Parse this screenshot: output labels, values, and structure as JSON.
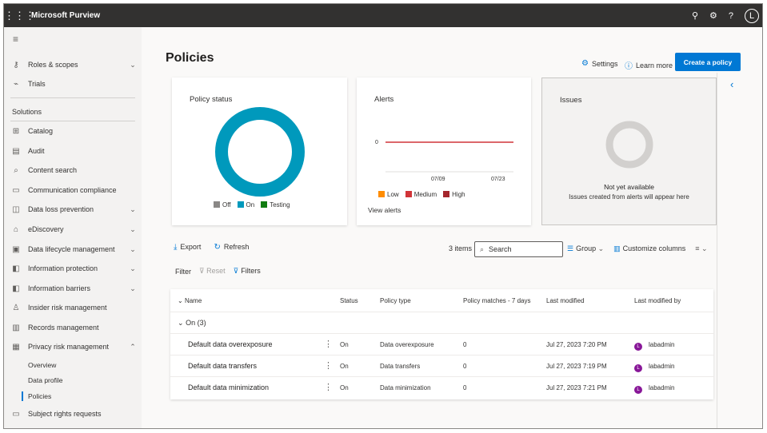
{
  "app": {
    "title": "Microsoft Purview",
    "avatar_initial": "L"
  },
  "topbar_icons": [
    "share-icon",
    "gear-icon",
    "help-icon"
  ],
  "sidebar": {
    "items_top": [
      {
        "label": "Roles & scopes",
        "icon": "key-icon",
        "chevron": true
      },
      {
        "label": "Trials",
        "icon": "trial-icon",
        "chevron": false
      }
    ],
    "solutions_heading": "Solutions",
    "items": [
      {
        "label": "Catalog",
        "icon": "catalog-icon",
        "chevron": false
      },
      {
        "label": "Audit",
        "icon": "audit-icon",
        "chevron": false
      },
      {
        "label": "Content search",
        "icon": "search-icon",
        "chevron": false
      },
      {
        "label": "Communication compliance",
        "icon": "chat-icon",
        "chevron": false
      },
      {
        "label": "Data loss prevention",
        "icon": "dlp-icon",
        "chevron": true
      },
      {
        "label": "eDiscovery",
        "icon": "ediscovery-icon",
        "chevron": true
      },
      {
        "label": "Data lifecycle management",
        "icon": "lifecycle-icon",
        "chevron": true
      },
      {
        "label": "Information protection",
        "icon": "protection-icon",
        "chevron": true
      },
      {
        "label": "Information barriers",
        "icon": "barrier-icon",
        "chevron": true
      },
      {
        "label": "Insider risk management",
        "icon": "insider-icon",
        "chevron": false
      },
      {
        "label": "Records management",
        "icon": "records-icon",
        "chevron": false
      },
      {
        "label": "Privacy risk management",
        "icon": "privacy-icon",
        "chevron": true
      }
    ],
    "subitems": [
      "Overview",
      "Data profile",
      "Policies"
    ],
    "bottom_item": {
      "label": "Subject rights requests",
      "icon": "subject-icon"
    }
  },
  "main": {
    "title": "Policies",
    "settings_label": "Settings",
    "learn_more_label": "Learn more",
    "create_label": "Create a policy"
  },
  "cards": {
    "policy_status": {
      "title": "Policy status",
      "legend": [
        {
          "label": "Off",
          "color": "#8a8886"
        },
        {
          "label": "On",
          "color": "#0099bc"
        },
        {
          "label": "Testing",
          "color": "#107c10"
        }
      ]
    },
    "alerts": {
      "title": "Alerts",
      "y_label": "0",
      "x_labels": [
        "07/09",
        "07/23"
      ],
      "legend": [
        {
          "label": "Low",
          "color": "#ff8c00"
        },
        {
          "label": "Medium",
          "color": "#d13438"
        },
        {
          "label": "High",
          "color": "#a4262c"
        }
      ],
      "link": "View alerts"
    },
    "issues": {
      "title": "Issues",
      "empty_title": "Not yet available",
      "empty_desc": "Issues created from alerts will appear here"
    }
  },
  "toolbar": {
    "export_label": "Export",
    "refresh_label": "Refresh",
    "count_label": "3 items",
    "search_placeholder": "Search",
    "group_label": "Group",
    "customize_label": "Customize columns"
  },
  "filterbar": {
    "filter_label": "Filter",
    "reset_label": "Reset",
    "filters_label": "Filters"
  },
  "table": {
    "headers": [
      "Name",
      "Status",
      "Policy type",
      "Policy matches - 7 days",
      "Last modified",
      "Last modified by"
    ],
    "group_label": "On (3)",
    "rows": [
      {
        "name": "Default data overexposure",
        "status": "On",
        "type": "Data overexposure",
        "matches": "0",
        "modified": "Jul 27, 2023 7:20 PM",
        "by": "labadmin"
      },
      {
        "name": "Default data transfers",
        "status": "On",
        "type": "Data transfers",
        "matches": "0",
        "modified": "Jul 27, 2023 7:19 PM",
        "by": "labadmin"
      },
      {
        "name": "Default data minimization",
        "status": "On",
        "type": "Data minimization",
        "matches": "0",
        "modified": "Jul 27, 2023 7:21 PM",
        "by": "labadmin"
      }
    ]
  },
  "chart_data": [
    {
      "type": "pie",
      "title": "Policy status",
      "categories": [
        "Off",
        "On",
        "Testing"
      ],
      "values": [
        0,
        3,
        0
      ]
    },
    {
      "type": "line",
      "title": "Alerts",
      "x": [
        "07/09",
        "07/23"
      ],
      "series": [
        {
          "name": "Low",
          "values": [
            0,
            0
          ]
        },
        {
          "name": "Medium",
          "values": [
            0,
            0
          ]
        },
        {
          "name": "High",
          "values": [
            0,
            0
          ]
        }
      ]
    }
  ]
}
